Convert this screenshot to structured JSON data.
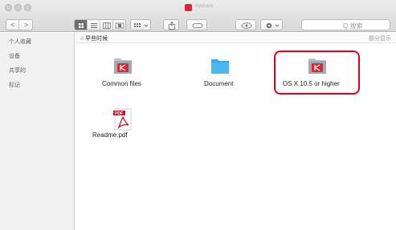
{
  "window": {
    "title": "Kyocera"
  },
  "toolbar": {
    "back_label": "<",
    "forward_label": ">",
    "search_placeholder": "Q 搜索"
  },
  "sidebar": {
    "items": [
      {
        "label": "个人收藏"
      },
      {
        "label": "设备"
      },
      {
        "label": "共享的"
      },
      {
        "label": "标记"
      }
    ]
  },
  "pathbar": {
    "left_label": "○ 早些时候",
    "right_label": "部分显示"
  },
  "files": [
    {
      "name": "Common files",
      "icon": "folder-kyocera-icon"
    },
    {
      "name": "Document",
      "icon": "folder-icon"
    },
    {
      "name": "OS X 10.5 or higher",
      "icon": "folder-kyocera-icon"
    },
    {
      "name": "Readme.pdf",
      "icon": "pdf-icon"
    }
  ],
  "colors": {
    "highlight": "#e0001b",
    "folder_blue": "#4bb8f0",
    "brand_red": "#d62a35"
  }
}
